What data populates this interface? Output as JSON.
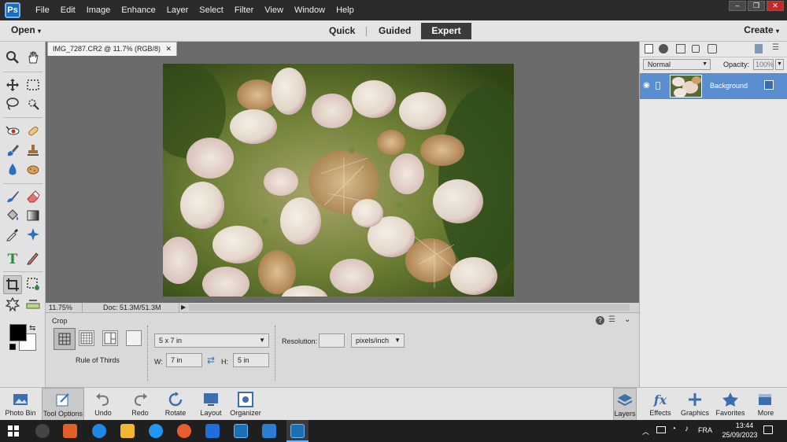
{
  "menubar": {
    "items": [
      "File",
      "Edit",
      "Image",
      "Enhance",
      "Layer",
      "Select",
      "Filter",
      "View",
      "Window",
      "Help"
    ],
    "controls": [
      "–",
      "❐",
      "✕"
    ]
  },
  "modebar": {
    "open_label": "Open",
    "modes": [
      "Quick",
      "Guided",
      "Expert"
    ],
    "active_mode": "Expert",
    "create_label": "Create"
  },
  "document": {
    "tab_title": "IMG_7287.CR2 @ 11.7% (RGB/8)",
    "zoom": "11.75%",
    "doc_size": "Doc: 51.3M/51.3M"
  },
  "tool_options": {
    "section_title": "Crop",
    "preset_caption": "Rule of Thirds",
    "aspect_value": "5 x 7 in",
    "width_label": "W:",
    "width_value": "7 in",
    "height_label": "H:",
    "height_value": "5 in",
    "resolution_label": "Resolution:",
    "resolution_value": "",
    "units_value": "pixels/inch"
  },
  "layers_panel": {
    "blend_mode": "Normal",
    "opacity_label": "Opacity:",
    "opacity_value": "100%",
    "layer_name": "Background"
  },
  "taskbin": {
    "left": [
      "Photo Bin",
      "Tool Options",
      "Undo",
      "Redo",
      "Rotate",
      "Layout",
      "Organizer"
    ],
    "right": [
      "Layers",
      "Effects",
      "Graphics",
      "Favorites",
      "More"
    ]
  },
  "windows_taskbar": {
    "language": "FRA",
    "time": "13:44",
    "date": "25/09/2023"
  },
  "colors": {
    "accent": "#5b8ed1",
    "expert_bg": "#3b3b3b",
    "menubar": "#2b2b2b"
  }
}
